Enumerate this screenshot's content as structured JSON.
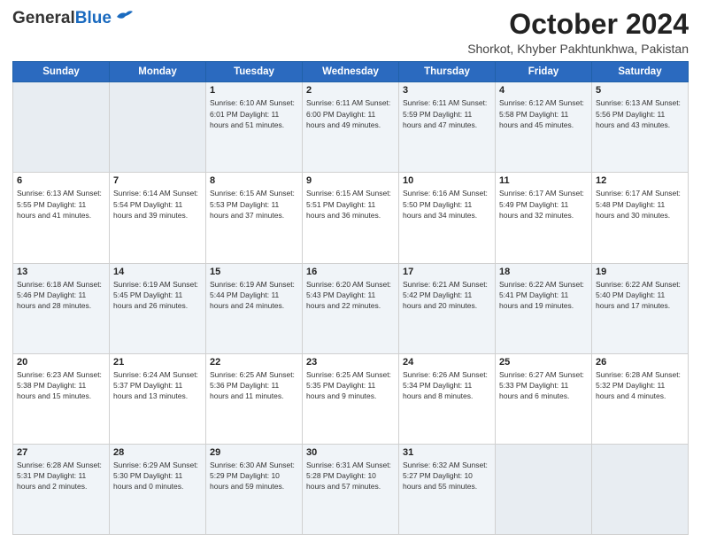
{
  "header": {
    "logo_general": "General",
    "logo_blue": "Blue",
    "month_title": "October 2024",
    "location": "Shorkot, Khyber Pakhtunkhwa, Pakistan"
  },
  "days_of_week": [
    "Sunday",
    "Monday",
    "Tuesday",
    "Wednesday",
    "Thursday",
    "Friday",
    "Saturday"
  ],
  "weeks": [
    [
      {
        "day": "",
        "detail": ""
      },
      {
        "day": "",
        "detail": ""
      },
      {
        "day": "1",
        "detail": "Sunrise: 6:10 AM\nSunset: 6:01 PM\nDaylight: 11 hours and 51 minutes."
      },
      {
        "day": "2",
        "detail": "Sunrise: 6:11 AM\nSunset: 6:00 PM\nDaylight: 11 hours and 49 minutes."
      },
      {
        "day": "3",
        "detail": "Sunrise: 6:11 AM\nSunset: 5:59 PM\nDaylight: 11 hours and 47 minutes."
      },
      {
        "day": "4",
        "detail": "Sunrise: 6:12 AM\nSunset: 5:58 PM\nDaylight: 11 hours and 45 minutes."
      },
      {
        "day": "5",
        "detail": "Sunrise: 6:13 AM\nSunset: 5:56 PM\nDaylight: 11 hours and 43 minutes."
      }
    ],
    [
      {
        "day": "6",
        "detail": "Sunrise: 6:13 AM\nSunset: 5:55 PM\nDaylight: 11 hours and 41 minutes."
      },
      {
        "day": "7",
        "detail": "Sunrise: 6:14 AM\nSunset: 5:54 PM\nDaylight: 11 hours and 39 minutes."
      },
      {
        "day": "8",
        "detail": "Sunrise: 6:15 AM\nSunset: 5:53 PM\nDaylight: 11 hours and 37 minutes."
      },
      {
        "day": "9",
        "detail": "Sunrise: 6:15 AM\nSunset: 5:51 PM\nDaylight: 11 hours and 36 minutes."
      },
      {
        "day": "10",
        "detail": "Sunrise: 6:16 AM\nSunset: 5:50 PM\nDaylight: 11 hours and 34 minutes."
      },
      {
        "day": "11",
        "detail": "Sunrise: 6:17 AM\nSunset: 5:49 PM\nDaylight: 11 hours and 32 minutes."
      },
      {
        "day": "12",
        "detail": "Sunrise: 6:17 AM\nSunset: 5:48 PM\nDaylight: 11 hours and 30 minutes."
      }
    ],
    [
      {
        "day": "13",
        "detail": "Sunrise: 6:18 AM\nSunset: 5:46 PM\nDaylight: 11 hours and 28 minutes."
      },
      {
        "day": "14",
        "detail": "Sunrise: 6:19 AM\nSunset: 5:45 PM\nDaylight: 11 hours and 26 minutes."
      },
      {
        "day": "15",
        "detail": "Sunrise: 6:19 AM\nSunset: 5:44 PM\nDaylight: 11 hours and 24 minutes."
      },
      {
        "day": "16",
        "detail": "Sunrise: 6:20 AM\nSunset: 5:43 PM\nDaylight: 11 hours and 22 minutes."
      },
      {
        "day": "17",
        "detail": "Sunrise: 6:21 AM\nSunset: 5:42 PM\nDaylight: 11 hours and 20 minutes."
      },
      {
        "day": "18",
        "detail": "Sunrise: 6:22 AM\nSunset: 5:41 PM\nDaylight: 11 hours and 19 minutes."
      },
      {
        "day": "19",
        "detail": "Sunrise: 6:22 AM\nSunset: 5:40 PM\nDaylight: 11 hours and 17 minutes."
      }
    ],
    [
      {
        "day": "20",
        "detail": "Sunrise: 6:23 AM\nSunset: 5:38 PM\nDaylight: 11 hours and 15 minutes."
      },
      {
        "day": "21",
        "detail": "Sunrise: 6:24 AM\nSunset: 5:37 PM\nDaylight: 11 hours and 13 minutes."
      },
      {
        "day": "22",
        "detail": "Sunrise: 6:25 AM\nSunset: 5:36 PM\nDaylight: 11 hours and 11 minutes."
      },
      {
        "day": "23",
        "detail": "Sunrise: 6:25 AM\nSunset: 5:35 PM\nDaylight: 11 hours and 9 minutes."
      },
      {
        "day": "24",
        "detail": "Sunrise: 6:26 AM\nSunset: 5:34 PM\nDaylight: 11 hours and 8 minutes."
      },
      {
        "day": "25",
        "detail": "Sunrise: 6:27 AM\nSunset: 5:33 PM\nDaylight: 11 hours and 6 minutes."
      },
      {
        "day": "26",
        "detail": "Sunrise: 6:28 AM\nSunset: 5:32 PM\nDaylight: 11 hours and 4 minutes."
      }
    ],
    [
      {
        "day": "27",
        "detail": "Sunrise: 6:28 AM\nSunset: 5:31 PM\nDaylight: 11 hours and 2 minutes."
      },
      {
        "day": "28",
        "detail": "Sunrise: 6:29 AM\nSunset: 5:30 PM\nDaylight: 11 hours and 0 minutes."
      },
      {
        "day": "29",
        "detail": "Sunrise: 6:30 AM\nSunset: 5:29 PM\nDaylight: 10 hours and 59 minutes."
      },
      {
        "day": "30",
        "detail": "Sunrise: 6:31 AM\nSunset: 5:28 PM\nDaylight: 10 hours and 57 minutes."
      },
      {
        "day": "31",
        "detail": "Sunrise: 6:32 AM\nSunset: 5:27 PM\nDaylight: 10 hours and 55 minutes."
      },
      {
        "day": "",
        "detail": ""
      },
      {
        "day": "",
        "detail": ""
      }
    ]
  ]
}
